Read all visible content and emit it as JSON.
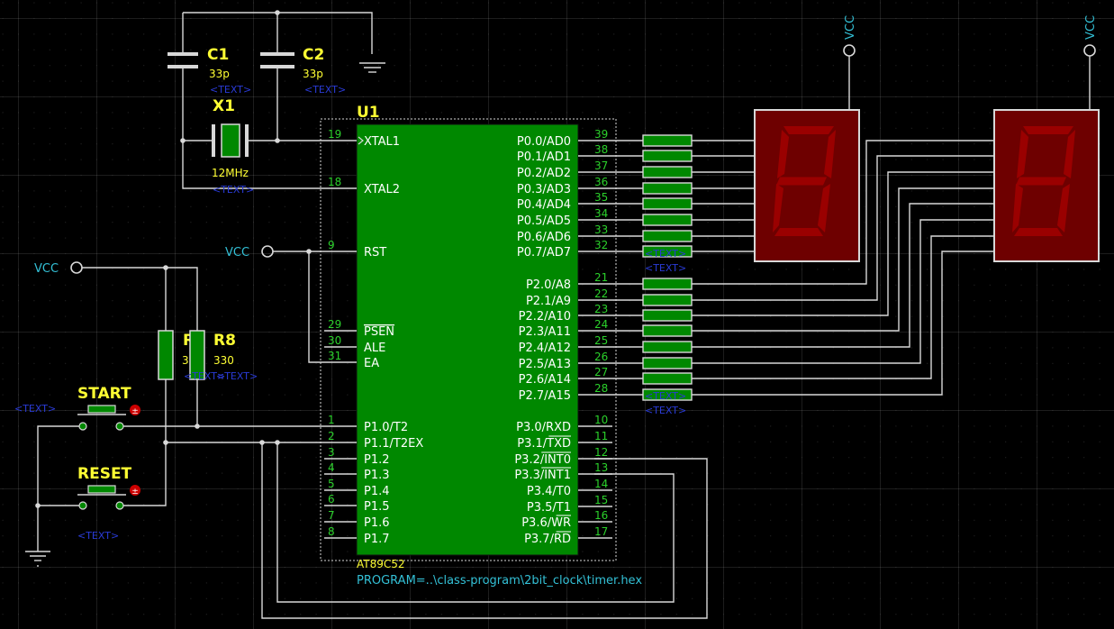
{
  "colors": {
    "background": "#000000",
    "grid": "#3a3a3a",
    "wire": "#d8d8d8",
    "chip_fill": "#008800",
    "pin_number": "#2bd12b",
    "ref_label": "#ffff33",
    "power_label": "#33c0d6",
    "placeholder": "#2a3bd6",
    "segment_body": "#6e0000",
    "segment_off": "#9a0000"
  },
  "mcu": {
    "ref": "U1",
    "part": "AT89C52",
    "program": "PROGRAM=..\\class-program\\2bit_clock\\timer.hex",
    "left_pins": [
      {
        "num": "19",
        "name": "XTAL1"
      },
      {
        "num": "18",
        "name": "XTAL2"
      },
      {
        "num": "9",
        "name": "RST"
      },
      {
        "num": "29",
        "name": "PSEN"
      },
      {
        "num": "30",
        "name": "ALE"
      },
      {
        "num": "31",
        "name": "EA"
      },
      {
        "num": "1",
        "name": "P1.0/T2"
      },
      {
        "num": "2",
        "name": "P1.1/T2EX"
      },
      {
        "num": "3",
        "name": "P1.2"
      },
      {
        "num": "4",
        "name": "P1.3"
      },
      {
        "num": "5",
        "name": "P1.4"
      },
      {
        "num": "6",
        "name": "P1.5"
      },
      {
        "num": "7",
        "name": "P1.6"
      },
      {
        "num": "8",
        "name": "P1.7"
      }
    ],
    "right_pins": [
      {
        "num": "39",
        "name": "P0.0/AD0"
      },
      {
        "num": "38",
        "name": "P0.1/AD1"
      },
      {
        "num": "37",
        "name": "P0.2/AD2"
      },
      {
        "num": "36",
        "name": "P0.3/AD3"
      },
      {
        "num": "35",
        "name": "P0.4/AD4"
      },
      {
        "num": "34",
        "name": "P0.5/AD5"
      },
      {
        "num": "33",
        "name": "P0.6/AD6"
      },
      {
        "num": "32",
        "name": "P0.7/AD7"
      },
      {
        "num": "21",
        "name": "P2.0/A8"
      },
      {
        "num": "22",
        "name": "P2.1/A9"
      },
      {
        "num": "23",
        "name": "P2.2/A10"
      },
      {
        "num": "24",
        "name": "P2.3/A11"
      },
      {
        "num": "25",
        "name": "P2.4/A12"
      },
      {
        "num": "26",
        "name": "P2.5/A13"
      },
      {
        "num": "27",
        "name": "P2.6/A14"
      },
      {
        "num": "28",
        "name": "P2.7/A15"
      },
      {
        "num": "10",
        "name": "P3.0/RXD"
      },
      {
        "num": "11",
        "name": "P3.1/TXD"
      },
      {
        "num": "12",
        "name": "P3.2/INT0"
      },
      {
        "num": "13",
        "name": "P3.3/INT1"
      },
      {
        "num": "14",
        "name": "P3.4/T0"
      },
      {
        "num": "15",
        "name": "P3.5/T1"
      },
      {
        "num": "16",
        "name": "P3.6/WR"
      },
      {
        "num": "17",
        "name": "P3.7/RD"
      }
    ]
  },
  "capacitors": [
    {
      "ref": "C1",
      "value": "33p"
    },
    {
      "ref": "C2",
      "value": "33p"
    }
  ],
  "crystal": {
    "ref": "X1",
    "value": "12MHz"
  },
  "resistors": [
    {
      "ref": "R9",
      "value": "330"
    },
    {
      "ref": "R8",
      "value": "330"
    }
  ],
  "buttons": [
    {
      "ref": "START"
    },
    {
      "ref": "RESET"
    }
  ],
  "power": {
    "vcc": "VCC"
  },
  "placeholder": "<TEXT>"
}
